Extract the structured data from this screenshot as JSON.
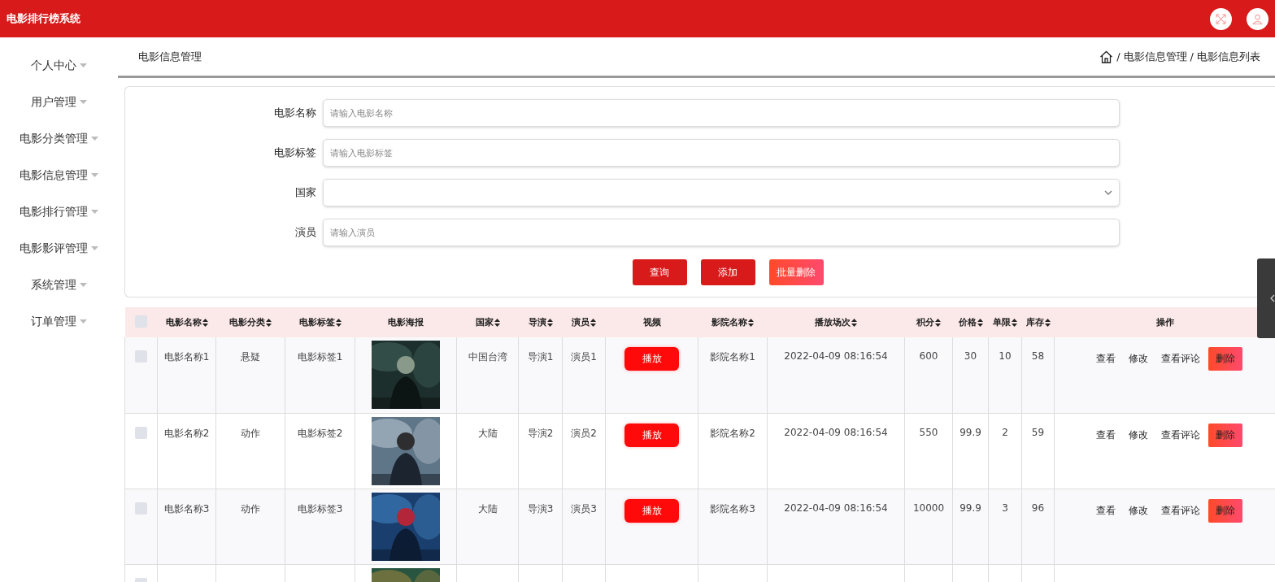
{
  "app_title": "电影排行榜系统",
  "header_icons": [
    {
      "kind": "fullscreen"
    },
    {
      "kind": "user"
    }
  ],
  "sidebar": {
    "items": [
      {
        "label": "个人中心"
      },
      {
        "label": "用户管理"
      },
      {
        "label": "电影分类管理"
      },
      {
        "label": "电影信息管理"
      },
      {
        "label": "电影排行管理"
      },
      {
        "label": "电影影评管理"
      },
      {
        "label": "系统管理"
      },
      {
        "label": "订单管理"
      }
    ]
  },
  "page_title": "电影信息管理",
  "breadcrumb": [
    {
      "separator": "/",
      "label": "电影信息管理"
    },
    {
      "separator": "/",
      "label": "电影信息列表"
    }
  ],
  "search_form": {
    "fields": [
      {
        "label": "电影名称",
        "kind": "text",
        "placeholder": "请输入电影名称"
      },
      {
        "label": "电影标签",
        "kind": "text",
        "placeholder": "请输入电影标签"
      },
      {
        "label": "国家",
        "kind": "select"
      },
      {
        "label": "演员",
        "kind": "text",
        "placeholder": "请输入演员"
      }
    ],
    "buttons": [
      {
        "label": "查询",
        "kind": "primary"
      },
      {
        "label": "添加",
        "kind": "primary"
      },
      {
        "label": "批量删除",
        "kind": "danger"
      }
    ]
  },
  "table": {
    "select_all": {
      "checked": false
    },
    "columns": [
      {
        "label": "电影名称",
        "sortable": true
      },
      {
        "label": "电影分类",
        "sortable": true
      },
      {
        "label": "电影标签",
        "sortable": true
      },
      {
        "label": "电影海报",
        "sortable": false
      },
      {
        "label": "国家",
        "sortable": true
      },
      {
        "label": "导演",
        "sortable": true
      },
      {
        "label": "演员",
        "sortable": true
      },
      {
        "label": "视频",
        "sortable": false
      },
      {
        "label": "影院名称",
        "sortable": true
      },
      {
        "label": "播放场次",
        "sortable": true
      },
      {
        "label": "积分",
        "sortable": true
      },
      {
        "label": "价格",
        "sortable": true
      },
      {
        "label": "单限",
        "sortable": true
      },
      {
        "label": "库存",
        "sortable": true
      },
      {
        "label": "操作",
        "sortable": false
      }
    ],
    "rows": [
      {
        "checked": false,
        "cells": [
          {
            "kind": "text",
            "text": "电影名称1"
          },
          {
            "kind": "text",
            "text": "悬疑"
          },
          {
            "kind": "text",
            "text": "电影标签1"
          },
          {
            "kind": "picture"
          },
          {
            "kind": "text",
            "text": "中国台湾"
          },
          {
            "kind": "text",
            "text": "导演1"
          },
          {
            "kind": "text",
            "text": "演员1"
          },
          {
            "kind": "button",
            "text": "播放"
          },
          {
            "kind": "text",
            "text": "影院名称1"
          },
          {
            "kind": "text",
            "text": "2022-04-09 08:16:54"
          },
          {
            "kind": "text",
            "text": "600"
          },
          {
            "kind": "text",
            "text": "30"
          },
          {
            "kind": "text",
            "text": "10"
          },
          {
            "kind": "text",
            "text": "58"
          },
          {
            "kind": "actions",
            "links": [
              "查看",
              "修改",
              "查看评论"
            ],
            "delete_button": "删除"
          }
        ]
      },
      {
        "checked": false,
        "cells": [
          {
            "kind": "text",
            "text": "电影名称2"
          },
          {
            "kind": "text",
            "text": "动作"
          },
          {
            "kind": "text",
            "text": "电影标签2"
          },
          {
            "kind": "picture"
          },
          {
            "kind": "text",
            "text": "大陆"
          },
          {
            "kind": "text",
            "text": "导演2"
          },
          {
            "kind": "text",
            "text": "演员2"
          },
          {
            "kind": "button",
            "text": "播放"
          },
          {
            "kind": "text",
            "text": "影院名称2"
          },
          {
            "kind": "text",
            "text": "2022-04-09 08:16:54"
          },
          {
            "kind": "text",
            "text": "550"
          },
          {
            "kind": "text",
            "text": "99.9"
          },
          {
            "kind": "text",
            "text": "2"
          },
          {
            "kind": "text",
            "text": "59"
          },
          {
            "kind": "actions",
            "links": [
              "查看",
              "修改",
              "查看评论"
            ],
            "delete_button": "删除"
          }
        ]
      },
      {
        "checked": false,
        "cells": [
          {
            "kind": "text",
            "text": "电影名称3"
          },
          {
            "kind": "text",
            "text": "动作"
          },
          {
            "kind": "text",
            "text": "电影标签3"
          },
          {
            "kind": "picture"
          },
          {
            "kind": "text",
            "text": "大陆"
          },
          {
            "kind": "text",
            "text": "导演3"
          },
          {
            "kind": "text",
            "text": "演员3"
          },
          {
            "kind": "button",
            "text": "播放"
          },
          {
            "kind": "text",
            "text": "影院名称3"
          },
          {
            "kind": "text",
            "text": "2022-04-09 08:16:54"
          },
          {
            "kind": "text",
            "text": "10000"
          },
          {
            "kind": "text",
            "text": "99.9"
          },
          {
            "kind": "text",
            "text": "3"
          },
          {
            "kind": "text",
            "text": "96"
          },
          {
            "kind": "actions",
            "links": [
              "查看",
              "修改",
              "查看评论"
            ],
            "delete_button": "删除"
          }
        ]
      }
    ],
    "partial_row": {
      "checked": false,
      "poster": {
        "kind": "picture"
      }
    }
  }
}
